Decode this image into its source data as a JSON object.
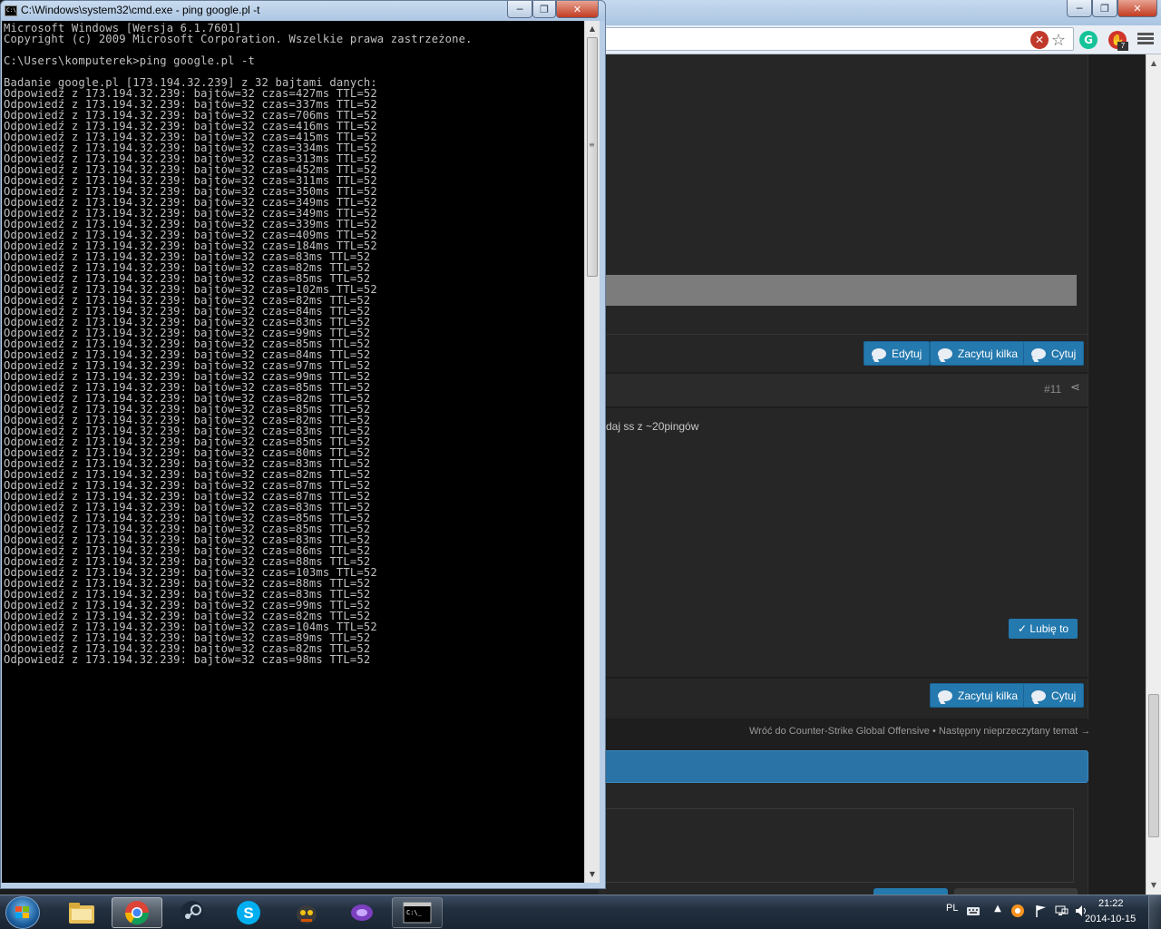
{
  "cmd": {
    "title": "C:\\Windows\\system32\\cmd.exe - ping  google.pl -t",
    "icon_label": "C:\\",
    "lines": [
      "Microsoft Windows [Wersja 6.1.7601]",
      "Copyright (c) 2009 Microsoft Corporation. Wszelkie prawa zastrzeżone.",
      "",
      "C:\\Users\\komputerek>ping google.pl -t",
      "",
      "Badanie google.pl [173.194.32.239] z 32 bajtami danych:",
      "Odpowiedź z 173.194.32.239: bajtów=32 czas=427ms TTL=52",
      "Odpowiedź z 173.194.32.239: bajtów=32 czas=337ms TTL=52",
      "Odpowiedź z 173.194.32.239: bajtów=32 czas=706ms TTL=52",
      "Odpowiedź z 173.194.32.239: bajtów=32 czas=416ms TTL=52",
      "Odpowiedź z 173.194.32.239: bajtów=32 czas=415ms TTL=52",
      "Odpowiedź z 173.194.32.239: bajtów=32 czas=334ms TTL=52",
      "Odpowiedź z 173.194.32.239: bajtów=32 czas=313ms TTL=52",
      "Odpowiedź z 173.194.32.239: bajtów=32 czas=452ms TTL=52",
      "Odpowiedź z 173.194.32.239: bajtów=32 czas=311ms TTL=52",
      "Odpowiedź z 173.194.32.239: bajtów=32 czas=350ms TTL=52",
      "Odpowiedź z 173.194.32.239: bajtów=32 czas=349ms TTL=52",
      "Odpowiedź z 173.194.32.239: bajtów=32 czas=349ms TTL=52",
      "Odpowiedź z 173.194.32.239: bajtów=32 czas=339ms TTL=52",
      "Odpowiedź z 173.194.32.239: bajtów=32 czas=409ms TTL=52",
      "Odpowiedź z 173.194.32.239: bajtów=32 czas=184ms TTL=52",
      "Odpowiedź z 173.194.32.239: bajtów=32 czas=83ms TTL=52",
      "Odpowiedź z 173.194.32.239: bajtów=32 czas=82ms TTL=52",
      "Odpowiedź z 173.194.32.239: bajtów=32 czas=85ms TTL=52",
      "Odpowiedź z 173.194.32.239: bajtów=32 czas=102ms TTL=52",
      "Odpowiedź z 173.194.32.239: bajtów=32 czas=82ms TTL=52",
      "Odpowiedź z 173.194.32.239: bajtów=32 czas=84ms TTL=52",
      "Odpowiedź z 173.194.32.239: bajtów=32 czas=83ms TTL=52",
      "Odpowiedź z 173.194.32.239: bajtów=32 czas=99ms TTL=52",
      "Odpowiedź z 173.194.32.239: bajtów=32 czas=85ms TTL=52",
      "Odpowiedź z 173.194.32.239: bajtów=32 czas=84ms TTL=52",
      "Odpowiedź z 173.194.32.239: bajtów=32 czas=97ms TTL=52",
      "Odpowiedź z 173.194.32.239: bajtów=32 czas=99ms TTL=52",
      "Odpowiedź z 173.194.32.239: bajtów=32 czas=85ms TTL=52",
      "Odpowiedź z 173.194.32.239: bajtów=32 czas=82ms TTL=52",
      "Odpowiedź z 173.194.32.239: bajtów=32 czas=85ms TTL=52",
      "Odpowiedź z 173.194.32.239: bajtów=32 czas=82ms TTL=52",
      "Odpowiedź z 173.194.32.239: bajtów=32 czas=83ms TTL=52",
      "Odpowiedź z 173.194.32.239: bajtów=32 czas=85ms TTL=52",
      "Odpowiedź z 173.194.32.239: bajtów=32 czas=80ms TTL=52",
      "Odpowiedź z 173.194.32.239: bajtów=32 czas=83ms TTL=52",
      "Odpowiedź z 173.194.32.239: bajtów=32 czas=82ms TTL=52",
      "Odpowiedź z 173.194.32.239: bajtów=32 czas=87ms TTL=52",
      "Odpowiedź z 173.194.32.239: bajtów=32 czas=87ms TTL=52",
      "Odpowiedź z 173.194.32.239: bajtów=32 czas=83ms TTL=52",
      "Odpowiedź z 173.194.32.239: bajtów=32 czas=85ms TTL=52",
      "Odpowiedź z 173.194.32.239: bajtów=32 czas=85ms TTL=52",
      "Odpowiedź z 173.194.32.239: bajtów=32 czas=83ms TTL=52",
      "Odpowiedź z 173.194.32.239: bajtów=32 czas=86ms TTL=52",
      "Odpowiedź z 173.194.32.239: bajtów=32 czas=88ms TTL=52",
      "Odpowiedź z 173.194.32.239: bajtów=32 czas=103ms TTL=52",
      "Odpowiedź z 173.194.32.239: bajtów=32 czas=88ms TTL=52",
      "Odpowiedź z 173.194.32.239: bajtów=32 czas=83ms TTL=52",
      "Odpowiedź z 173.194.32.239: bajtów=32 czas=99ms TTL=52",
      "Odpowiedź z 173.194.32.239: bajtów=32 czas=82ms TTL=52",
      "Odpowiedź z 173.194.32.239: bajtów=32 czas=104ms TTL=52",
      "Odpowiedź z 173.194.32.239: bajtów=32 czas=89ms TTL=52",
      "Odpowiedź z 173.194.32.239: bajtów=32 czas=82ms TTL=52",
      "Odpowiedź z 173.194.32.239: bajtów=32 czas=98ms TTL=52"
    ]
  },
  "browser": {
    "window_controls": {
      "minimize": "─",
      "maximize": "❐",
      "close": "✕"
    },
    "toolbar_icons": [
      "stop-icon",
      "star-icon",
      "grammarly-icon",
      "adblock-icon",
      "chrome-menu-icon"
    ],
    "adblock_badge": "7",
    "post1": {
      "buttons": {
        "edit": "Edytuj",
        "multiquote": "Zacytuj kilka",
        "quote": "Cytuj"
      }
    },
    "post2": {
      "number": "#11",
      "message": "daj ss z ~20pingów",
      "like_button": "✓ Lubię to",
      "buttons": {
        "multiquote": "Zacytuj kilka",
        "quote": "Cytuj"
      }
    },
    "footer": {
      "back_link": "Wróć do Counter-Strike Global Offensive",
      "separator": "•",
      "next_link": "Następny nieprzeczytany temat →"
    }
  },
  "taskbar": {
    "pinned": [
      "explorer-icon",
      "chrome-icon",
      "steam-icon",
      "skype-icon",
      "game-icon",
      "app-icon",
      "cmd-icon"
    ],
    "language": "PL",
    "time": "21:22",
    "date": "2014-10-15",
    "colors": {
      "accent": "#2479ae",
      "console_text": "#c0c0c0"
    }
  }
}
